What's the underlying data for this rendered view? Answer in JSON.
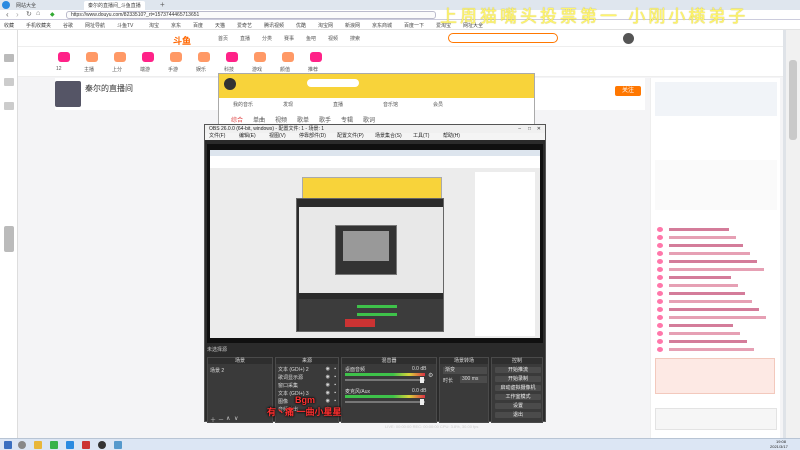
{
  "browser": {
    "tabs": [
      {
        "label": "网站大全",
        "active": false
      },
      {
        "label": "秦尔的直播间_斗鱼直播",
        "active": true
      }
    ],
    "url": "https://www.douyu.com/8233510?_rt=1573744465713651",
    "bookmarks": [
      "收藏",
      "手机收藏夹",
      "谷歌",
      "网址导航",
      "斗鱼TV",
      "淘宝",
      "京东",
      "百度",
      "天猫",
      "爱奇艺",
      "腾讯视频",
      "优酷",
      "淘宝网",
      "新浪网",
      "京东商城",
      "百度一下",
      "爱淘宝",
      "网址大全"
    ]
  },
  "overlay_title": "上周猫嘴头投票第一 小刚小横弟子",
  "douyu": {
    "nav": [
      "首页",
      "直播",
      "分类",
      "赛事",
      "鱼吧",
      "视频",
      "搜索"
    ],
    "category_items": [
      "12",
      "主播",
      "上分",
      "端游",
      "手游",
      "娱乐",
      "科技",
      "游戏",
      "颜值",
      "推荐"
    ],
    "streamer_name": "秦尔的直播间",
    "follow_label": "关注"
  },
  "dywin": {
    "tabs": [
      "综合",
      "单曲",
      "视频",
      "歌单",
      "歌手",
      "专辑",
      "歌词"
    ],
    "sub_items": [
      "我的音乐",
      "发现",
      "直播",
      "音乐馆",
      "会员"
    ]
  },
  "obs": {
    "title": "OBS 26.0.0 (64-bit, windows) - 配置文件: 1 - 场景: 1",
    "menu": [
      "文件(F)",
      "编辑(E)",
      "视图(V)",
      "停靠部件(D)",
      "配置文件(P)",
      "场景集合(S)",
      "工具(T)",
      "帮助(H)"
    ],
    "status_label": "未选择源",
    "docks": {
      "scenes": {
        "title": "场景",
        "items": [
          "场景 2"
        ]
      },
      "sources": {
        "title": "来源",
        "items": [
          "文本 (GDI+) 2",
          "歌词显示源",
          "窗口采集",
          "文本 (GDI+) 3",
          "图像",
          "音频输出"
        ]
      },
      "mixer": {
        "title": "混音器",
        "channels": [
          "桌面音频",
          "麦克风/Aux"
        ],
        "levels": [
          "0.0 dB",
          "0.0 dB"
        ]
      },
      "transitions": {
        "title": "场景转场",
        "mode": "渐变",
        "duration_label": "时长",
        "duration": "300 ms"
      },
      "controls": {
        "title": "控制",
        "buttons": [
          "开始推流",
          "开始录制",
          "启动虚拟摄像机",
          "工作室模式",
          "设置",
          "退出"
        ]
      }
    },
    "statusbar": "LIVE: 00:00:00   REC: 00:00:00   CPU: 3.8%, 30.00 fps"
  },
  "captions": {
    "line1": "Bgm",
    "line2": "有丶痛 一曲小星星"
  },
  "taskbar": {
    "time": "19:08",
    "date": "2021/3/17"
  }
}
